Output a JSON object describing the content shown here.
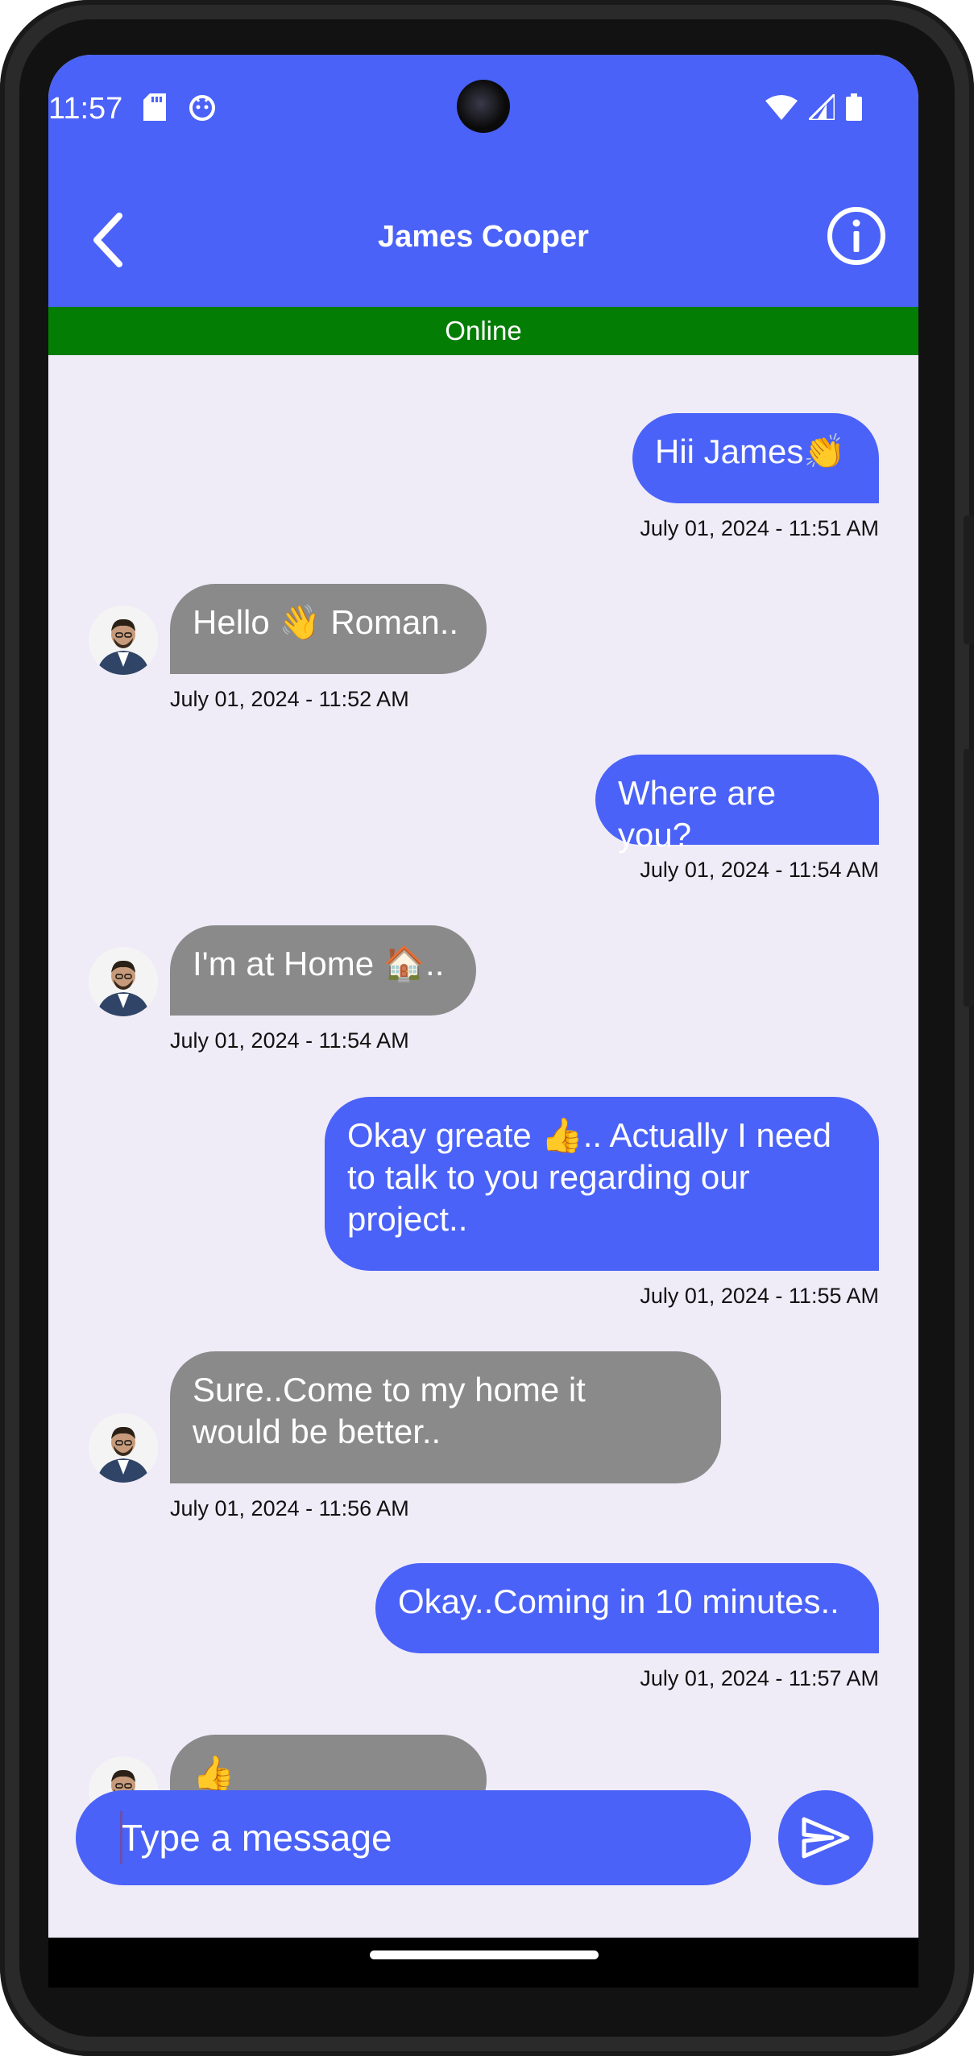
{
  "status_bar": {
    "time": "11:57"
  },
  "header": {
    "title": "James Cooper",
    "status": "Online"
  },
  "messages": [
    {
      "dir": "out",
      "text": "Hii James👏",
      "timestamp": "July 01, 2024 - 11:51 AM"
    },
    {
      "dir": "in",
      "text": "Hello 👋 Roman..",
      "timestamp": "July 01, 2024 - 11:52 AM"
    },
    {
      "dir": "out",
      "text": "Where are you?",
      "timestamp": "July 01, 2024 - 11:54 AM"
    },
    {
      "dir": "in",
      "text": "I'm at Home 🏠..",
      "timestamp": "July 01, 2024 - 11:54 AM"
    },
    {
      "dir": "out",
      "text": "Okay greate 👍.. Actually I need to talk to you regarding our project..",
      "timestamp": "July 01, 2024 - 11:55 AM"
    },
    {
      "dir": "in",
      "text": "Sure..Come to my home it would be better..",
      "timestamp": "July 01, 2024 - 11:56 AM"
    },
    {
      "dir": "out",
      "text": "Okay..Coming in 10 minutes..",
      "timestamp": "July 01, 2024 - 11:57 AM"
    },
    {
      "dir": "in",
      "text": "👍",
      "timestamp": ""
    }
  ],
  "composer": {
    "placeholder": "Type a message",
    "value": ""
  },
  "icons": {
    "back": "chevron-left-icon",
    "info": "info-icon",
    "send": "send-icon"
  },
  "colors": {
    "accent": "#4a62f8",
    "online": "#047d04",
    "incoming_bubble": "#8a8a8a",
    "background": "#efebf7"
  }
}
